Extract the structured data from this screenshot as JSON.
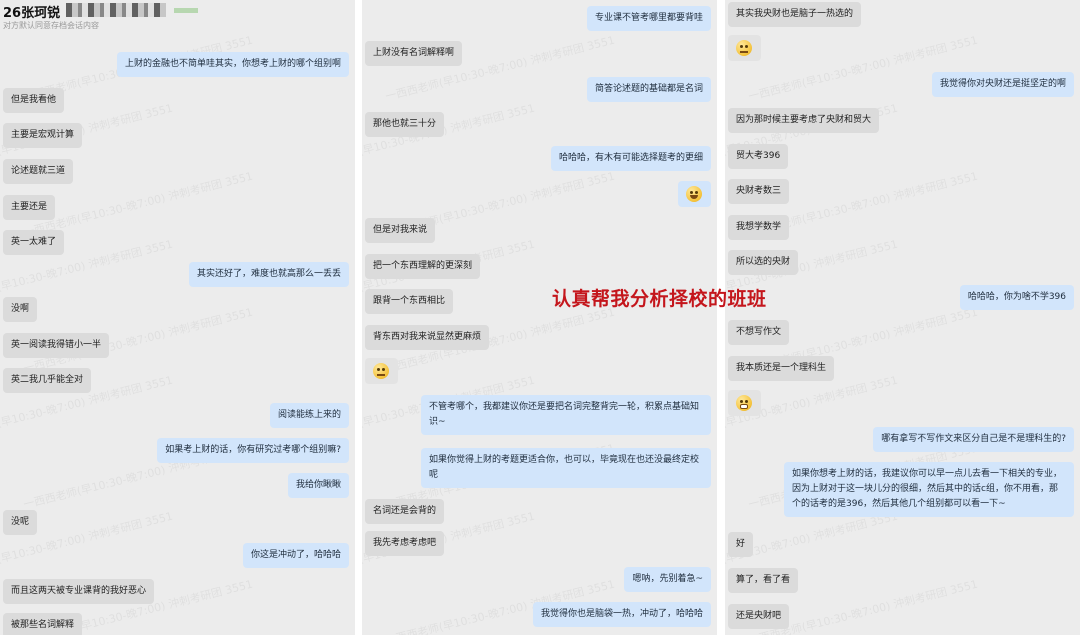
{
  "column1": {
    "contact_name": "26张珂锐",
    "notice": "对方默认同意存档会话内容",
    "messages": [
      "上财的金融也不简单哇其实，你想考上财的哪个组别啊",
      "但是我看他",
      "主要是宏观计算",
      "论述题就三道",
      "主要还是",
      "英一太难了",
      "其实还好了，难度也就高那么一丢丢",
      "没啊",
      "英一阅读我得错小一半",
      "英二我几乎能全对",
      "阅读能练上来的",
      "如果考上财的话，你有研究过考哪个组别嘛?",
      "我给你瞅瞅",
      "没呢",
      "你这是冲动了，哈哈哈",
      "而且这两天被专业课背的我好恶心",
      "被那些名词解释"
    ]
  },
  "column2": {
    "messages": [
      "专业课不管考哪里都要背哇",
      "上财没有名词解释啊",
      "简答论述题的基础都是名词",
      "那他也就三十分",
      "哈哈哈，有木有可能选择题考的更细",
      "但是对我来说",
      "把一个东西理解的更深刻",
      "跟背一个东西相比",
      "背东西对我来说显然更麻烦",
      "不管考哪个，我都建议你还是要把名词完整背完一轮，积累点基础知识~",
      "如果你觉得上财的考题更适合你，也可以，毕竟现在也还没最终定校呢",
      "名词还是会背的",
      "我先考虑考虑吧",
      "嗯呐，先别着急~",
      "我觉得你也是脑袋一热，冲动了，哈哈哈"
    ]
  },
  "column3": {
    "messages": [
      "其实我央财也是脑子一热选的",
      "我觉得你对央财还是挺坚定的啊",
      "因为那时候主要考虑了央财和贸大",
      "贸大考396",
      "央财考数三",
      "我想学数学",
      "所以选的央财",
      "哈哈哈，你为啥不学396",
      "不想写作文",
      "我本质还是一个理科生",
      "哪有拿写不写作文来区分自己是不是理科生的?",
      "如果你想考上财的话，我建议你可以早一点儿去看一下相关的专业，因为上财对于这一块儿分的很细，然后其中的话c组，你不用看，那个的话考的是396，然后其他几个组别都可以看一下~",
      "好",
      "算了，看了看",
      "还是央财吧"
    ]
  },
  "overlay_caption": "认真帮我分析择校的班班",
  "watermark_text": "一西西老师(早10:30-晚7:00) 沖刺考研团 3551",
  "colors": {
    "self_bubble": "#d2e5fb",
    "other_bubble": "#e3e3e3",
    "caption": "#c4161c"
  }
}
